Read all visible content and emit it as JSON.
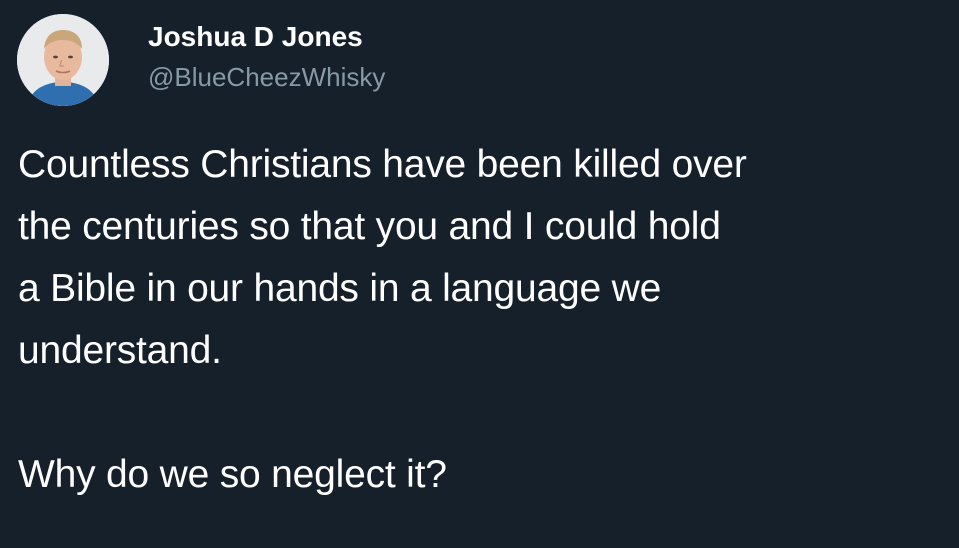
{
  "author": {
    "display_name": "Joshua D Jones",
    "handle": "@BlueCheezWhisky",
    "avatar_icon": "profile-photo"
  },
  "tweet": {
    "lines": [
      "Countless Christians have been killed over",
      "the centuries so that you and I could hold",
      "a Bible in our hands in a language we",
      "understand.",
      "Why do we so neglect it?"
    ]
  },
  "colors": {
    "background": "#15202b",
    "primary_text": "#ffffff",
    "secondary_text": "#8899a6"
  }
}
